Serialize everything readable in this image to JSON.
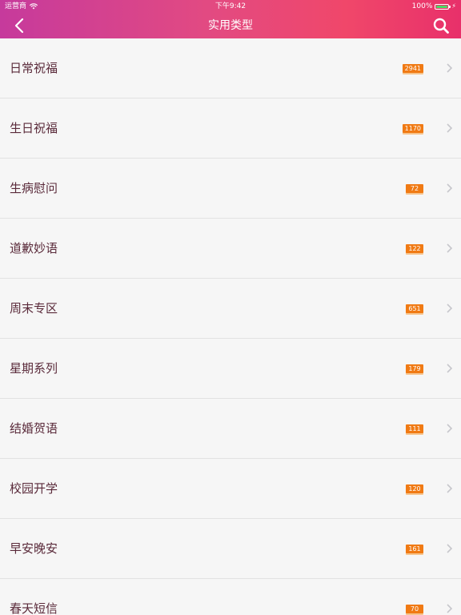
{
  "status_bar": {
    "carrier": "运营商",
    "time": "下午9:42",
    "battery_text": "100%",
    "battery_level": 1.0,
    "battery_color": "#4cd964"
  },
  "header": {
    "title": "实用类型",
    "back_icon": "chevron-left-icon",
    "search_icon": "search-icon",
    "gradient_colors": [
      "#c63a9c",
      "#e24a82",
      "#f0476a",
      "#e8306a"
    ]
  },
  "badge_color": "#f07a14",
  "list": {
    "items": [
      {
        "label": "日常祝福",
        "count": "2941"
      },
      {
        "label": "生日祝福",
        "count": "1170"
      },
      {
        "label": "生病慰问",
        "count": "72"
      },
      {
        "label": "道歉妙语",
        "count": "122"
      },
      {
        "label": "周末专区",
        "count": "651"
      },
      {
        "label": "星期系列",
        "count": "179"
      },
      {
        "label": "结婚贺语",
        "count": "111"
      },
      {
        "label": "校园开学",
        "count": "120"
      },
      {
        "label": "早安晚安",
        "count": "161"
      },
      {
        "label": "春天短信",
        "count": "70"
      }
    ]
  }
}
